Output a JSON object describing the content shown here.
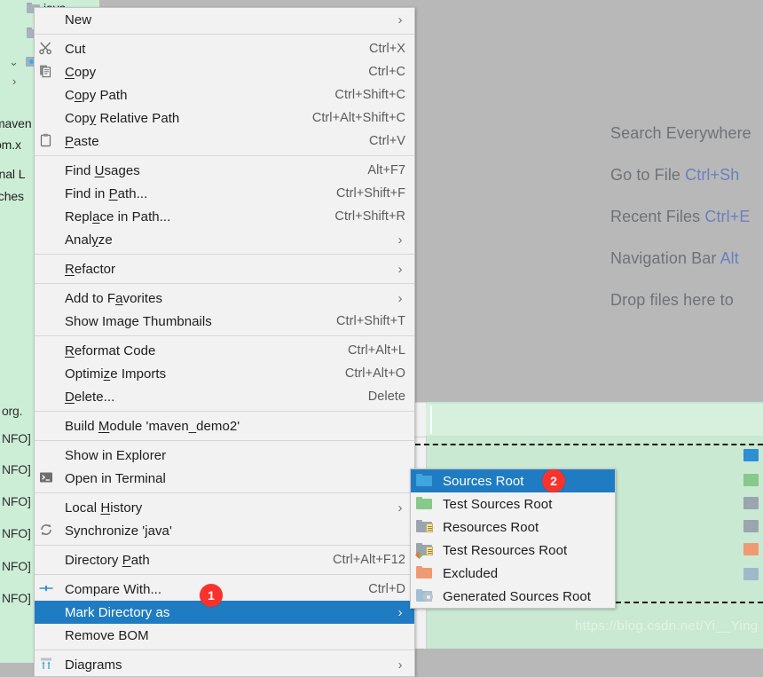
{
  "tree": {
    "items": [
      {
        "label": "java",
        "icon": "folder-icon"
      },
      {
        "label": "",
        "icon": "folder-icon"
      },
      {
        "label": "",
        "icon": "source-folder-icon"
      },
      {
        "label": "",
        "icon": "chevron-right-icon"
      },
      {
        "label": "maven",
        "icon": "none"
      },
      {
        "label": "om.x",
        "icon": "none"
      },
      {
        "label": "rnal L",
        "icon": "none"
      },
      {
        "label": "tches",
        "icon": "none"
      }
    ]
  },
  "console": {
    "lines": [
      "org.",
      "NFO]",
      "NFO]",
      "NFO]",
      "NFO]",
      "NFO]",
      "NFO]"
    ],
    "watermark": "https://blog.csdn.net/Yi__Ying"
  },
  "editor_placeholder": {
    "rows": [
      {
        "text": "Search Everywhere",
        "key": ""
      },
      {
        "text": "Go to File ",
        "key": "Ctrl+Sh"
      },
      {
        "text": "Recent Files ",
        "key": "Ctrl+E"
      },
      {
        "text": "Navigation Bar ",
        "key": "Alt"
      },
      {
        "text": "Drop files here to",
        "key": ""
      }
    ]
  },
  "context_menu": {
    "groups": [
      {
        "items": [
          {
            "label": "New",
            "accel": "",
            "arrow": "›",
            "icon": "none",
            "underline": "",
            "selected": false
          }
        ]
      },
      {
        "items": [
          {
            "label": "Cut",
            "accel": "Ctrl+X",
            "arrow": "",
            "icon": "scissors-icon",
            "underline": "t",
            "selected": false
          },
          {
            "label": "Copy",
            "accel": "Ctrl+C",
            "arrow": "",
            "icon": "copy-icon",
            "underline": "C",
            "selected": false
          },
          {
            "label": "Copy Path",
            "accel": "Ctrl+Shift+C",
            "arrow": "",
            "icon": "none",
            "underline": "o",
            "selected": false
          },
          {
            "label": "Copy Relative Path",
            "accel": "Ctrl+Alt+Shift+C",
            "arrow": "",
            "icon": "none",
            "underline": "y",
            "selected": false
          },
          {
            "label": "Paste",
            "accel": "Ctrl+V",
            "arrow": "",
            "icon": "paste-icon",
            "underline": "P",
            "selected": false
          }
        ]
      },
      {
        "items": [
          {
            "label": "Find Usages",
            "accel": "Alt+F7",
            "arrow": "",
            "icon": "none",
            "underline": "U",
            "selected": false
          },
          {
            "label": "Find in Path...",
            "accel": "Ctrl+Shift+F",
            "arrow": "",
            "icon": "none",
            "underline": "P",
            "selected": false
          },
          {
            "label": "Replace in Path...",
            "accel": "Ctrl+Shift+R",
            "arrow": "",
            "icon": "none",
            "underline": "a",
            "selected": false
          },
          {
            "label": "Analyze",
            "accel": "",
            "arrow": "›",
            "icon": "none",
            "underline": "y",
            "selected": false
          }
        ]
      },
      {
        "items": [
          {
            "label": "Refactor",
            "accel": "",
            "arrow": "›",
            "icon": "none",
            "underline": "R",
            "selected": false
          }
        ]
      },
      {
        "items": [
          {
            "label": "Add to Favorites",
            "accel": "",
            "arrow": "›",
            "icon": "none",
            "underline": "a",
            "selected": false
          },
          {
            "label": "Show Image Thumbnails",
            "accel": "Ctrl+Shift+T",
            "arrow": "",
            "icon": "none",
            "underline": "",
            "selected": false
          }
        ]
      },
      {
        "items": [
          {
            "label": "Reformat Code",
            "accel": "Ctrl+Alt+L",
            "arrow": "",
            "icon": "none",
            "underline": "R",
            "selected": false
          },
          {
            "label": "Optimize Imports",
            "accel": "Ctrl+Alt+O",
            "arrow": "",
            "icon": "none",
            "underline": "z",
            "selected": false
          },
          {
            "label": "Delete...",
            "accel": "Delete",
            "arrow": "",
            "icon": "none",
            "underline": "D",
            "selected": false
          }
        ]
      },
      {
        "items": [
          {
            "label": "Build Module 'maven_demo2'",
            "accel": "",
            "arrow": "",
            "icon": "none",
            "underline": "M",
            "selected": false
          }
        ]
      },
      {
        "items": [
          {
            "label": "Show in Explorer",
            "accel": "",
            "arrow": "",
            "icon": "none",
            "underline": "",
            "selected": false
          },
          {
            "label": "Open in Terminal",
            "accel": "",
            "arrow": "",
            "icon": "terminal-icon",
            "underline": "",
            "selected": false
          }
        ]
      },
      {
        "items": [
          {
            "label": "Local History",
            "accel": "",
            "arrow": "›",
            "icon": "none",
            "underline": "H",
            "selected": false
          },
          {
            "label": "Synchronize 'java'",
            "accel": "",
            "arrow": "",
            "icon": "sync-icon",
            "underline": "",
            "selected": false
          }
        ]
      },
      {
        "items": [
          {
            "label": "Directory Path",
            "accel": "Ctrl+Alt+F12",
            "arrow": "",
            "icon": "none",
            "underline": "P",
            "selected": false
          }
        ]
      },
      {
        "items": [
          {
            "label": "Compare With...",
            "accel": "Ctrl+D",
            "arrow": "",
            "icon": "compare-icon",
            "underline": "",
            "selected": false
          },
          {
            "label": "Mark Directory as",
            "accel": "",
            "arrow": "›",
            "icon": "none",
            "underline": "",
            "selected": true
          },
          {
            "label": "Remove BOM",
            "accel": "",
            "arrow": "",
            "icon": "none",
            "underline": "",
            "selected": false
          }
        ]
      },
      {
        "items": [
          {
            "label": "Diagrams",
            "accel": "",
            "arrow": "›",
            "icon": "diagram-icon",
            "underline": "",
            "selected": false
          }
        ]
      }
    ]
  },
  "submenu": {
    "items": [
      {
        "label": "Sources Root",
        "icon": "blue-folder-icon",
        "selected": true
      },
      {
        "label": "Test Sources Root",
        "icon": "green-folder-icon",
        "selected": false
      },
      {
        "label": "Resources Root",
        "icon": "resources-folder-icon",
        "selected": false
      },
      {
        "label": "Test Resources Root",
        "icon": "test-resources-folder-icon",
        "selected": false
      },
      {
        "label": "Excluded",
        "icon": "orange-folder-icon",
        "selected": false
      },
      {
        "label": "Generated Sources Root",
        "icon": "generated-folder-icon",
        "selected": false
      }
    ]
  },
  "badges": [
    {
      "number": "1",
      "name": "step-1-badge"
    },
    {
      "number": "2",
      "name": "step-2-badge"
    }
  ],
  "colors": {
    "selection_blue": "#1f7cc2",
    "badge_red": "#f9322c",
    "menu_bg": "#f2f2f2",
    "console_green": "#c9e9d2",
    "editor_gray": "#b8b8b8"
  }
}
